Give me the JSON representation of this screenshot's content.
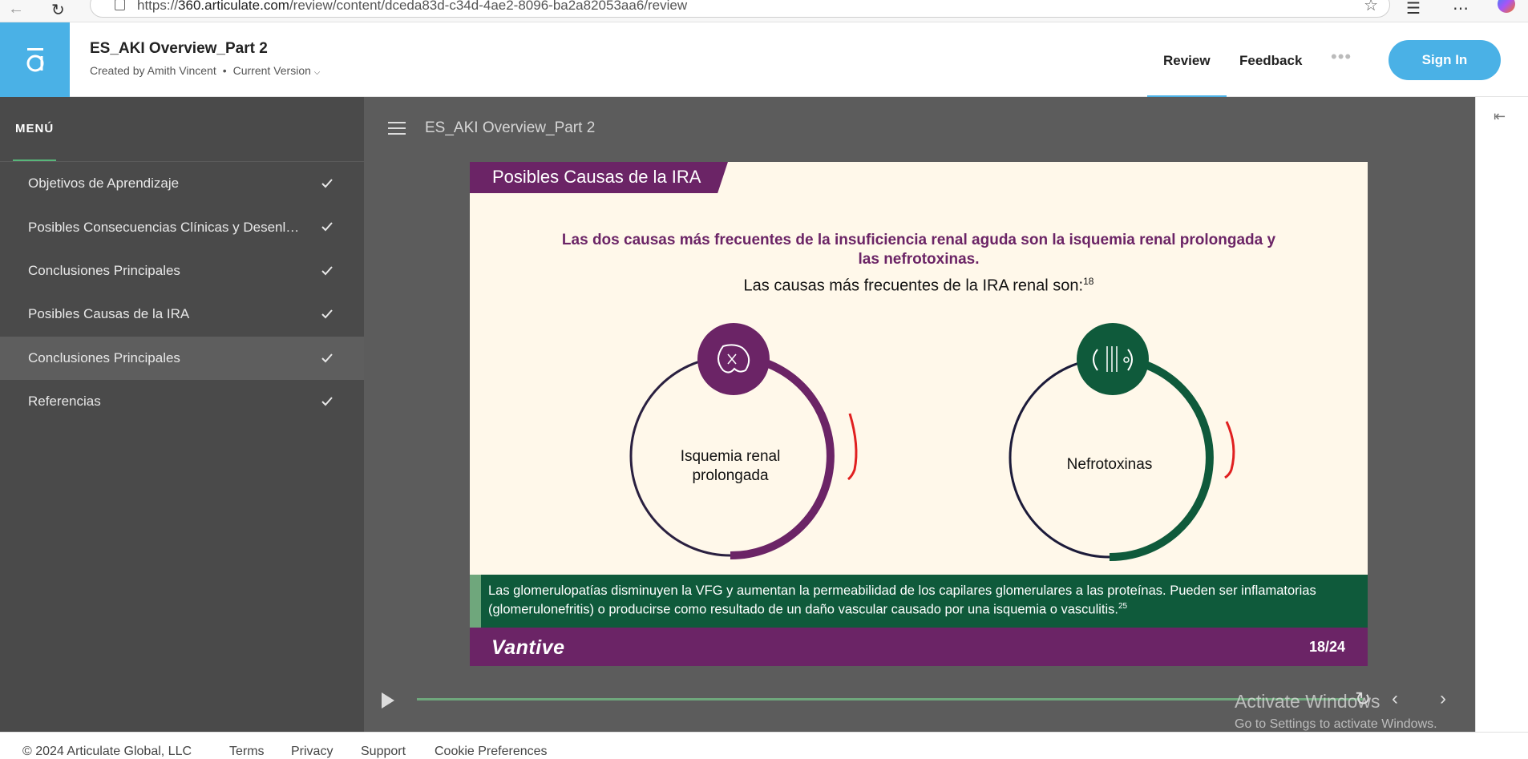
{
  "browser": {
    "url_prefix": "https://",
    "url_domain": "360.articulate.com",
    "url_path": "/review/content/dceda83d-c34d-4ae2-8096-ba2a82053aa6/review"
  },
  "header": {
    "title": "ES_AKI Overview_Part 2",
    "created_by": "Created by Amith Vincent",
    "version": "Current Version",
    "nav": [
      "Review",
      "Feedback"
    ],
    "more": "•••",
    "sign_in": "Sign In"
  },
  "sidebar": {
    "heading": "MENÚ",
    "items": [
      {
        "label": "Objetivos de Aprendizaje",
        "completed": true
      },
      {
        "label": "Posibles Consecuencias Clínicas y Desenlaces",
        "completed": true
      },
      {
        "label": "Conclusiones Principales",
        "completed": true
      },
      {
        "label": "Posibles Causas de la IRA",
        "completed": true
      },
      {
        "label": "Conclusiones Principales",
        "completed": true,
        "current": true
      },
      {
        "label": "Referencias",
        "completed": true
      }
    ]
  },
  "main": {
    "title": "ES_AKI Overview_Part 2"
  },
  "slide": {
    "tab_title": "Posibles Causas de la IRA",
    "lead": "Las dos causas más frecuentes de la insuficiencia renal aguda son la isquemia renal prolongada y las nefrotoxinas.",
    "subtitle": "Las causas más frecuentes de la IRA renal son:",
    "subtitle_ref": "18",
    "cause_left_line1": "Isquemia renal",
    "cause_left_line2": "prolongada",
    "cause_right": "Nefrotoxinas",
    "note": "Las glomerulopatías disminuyen la VFG y aumentan la permeabilidad de los capilares glomerulares a las proteínas. Pueden ser inflamatorias (glomerulonefritis) o producirse como resultado de un daño vascular causado por una isquemia o vasculitis.",
    "note_ref": "25",
    "brand": "Vantive",
    "page": "18/24"
  },
  "player": {
    "watermark_title": "Activate Windows",
    "watermark_sub": "Go to Settings to activate Windows."
  },
  "footer": {
    "copyright": "© 2024 Articulate Global, LLC",
    "links": [
      "Terms",
      "Privacy",
      "Support",
      "Cookie Preferences"
    ]
  },
  "colors": {
    "brand_blue": "#4ab1e6",
    "slide_purple": "#6b2466",
    "slide_green": "#0f5a3b",
    "sidebar_bg": "#4a4a4a"
  }
}
